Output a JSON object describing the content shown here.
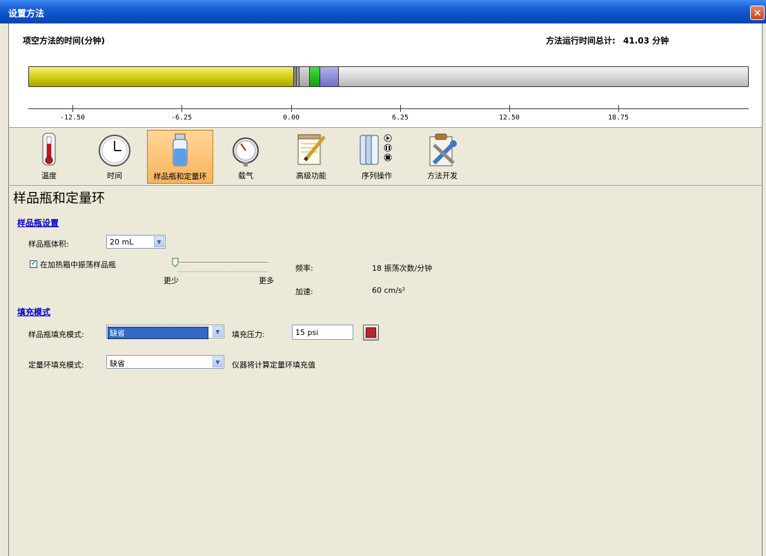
{
  "window": {
    "title": "设置方法",
    "close_icon": "close-icon"
  },
  "timeline": {
    "title": "项空方法的时间(分钟)",
    "total_label": "方法运行时间总计:",
    "total_value": "41.03 分钟",
    "ticks": [
      "-12.50",
      "-6.25",
      "0.00",
      "6.25",
      "12.50",
      "18.75"
    ]
  },
  "toolbar": {
    "items": [
      {
        "label": "温度",
        "icon": "thermometer-icon"
      },
      {
        "label": "时间",
        "icon": "clock-icon"
      },
      {
        "label": "样品瓶和定量环",
        "icon": "vial-icon"
      },
      {
        "label": "载气",
        "icon": "pressure-gauge-icon"
      },
      {
        "label": "高级功能",
        "icon": "notepad-pencil-icon"
      },
      {
        "label": "序列操作",
        "icon": "vials-sequence-icon"
      },
      {
        "label": "方法开发",
        "icon": "clipboard-tools-icon"
      }
    ],
    "active_index": 2
  },
  "page": {
    "title": "样品瓶和定量环",
    "vial_section": {
      "heading": "样品瓶设置",
      "volume_label": "样品瓶体积:",
      "volume_value": "20 mL",
      "shake_checkbox_label": "在加热箱中振荡样品瓶",
      "shake_checked": true,
      "slider_min_label": "更少",
      "slider_max_label": "更多",
      "slider_fraction": 0.0,
      "freq_label": "频率:",
      "freq_value": "18 振荡次数/分钟",
      "accel_label": "加速:",
      "accel_value": "60 cm/s²"
    },
    "fill_section": {
      "heading": "填充模式",
      "vial_fill_label": "样品瓶填充模式:",
      "vial_fill_value": "缺省",
      "pressure_label": "填充压力:",
      "pressure_value": "15 psi",
      "loop_fill_label": "定量环填充模式:",
      "loop_fill_value": "缺省",
      "loop_fill_note": "仪器将计算定量环填充值"
    }
  },
  "colors": {
    "accent_red": "#b22a2a",
    "titlebar_blue": "#0a4ec6",
    "active_tool": "#f8b25c"
  }
}
